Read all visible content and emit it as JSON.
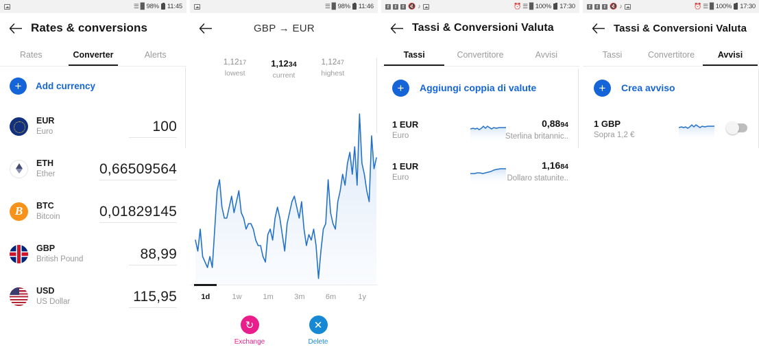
{
  "panels": {
    "p1": {
      "status": {
        "time": "11:45",
        "battery": "98%",
        "icons": [
          "image-icon",
          "wifi-icon",
          "signal-icon",
          "battery-icon"
        ]
      },
      "title": "Rates & conversions",
      "back_icon": "back-arrow-icon",
      "tabs": [
        {
          "label": "Rates",
          "active": false
        },
        {
          "label": "Converter",
          "active": true
        },
        {
          "label": "Alerts",
          "active": false
        }
      ],
      "add_currency": {
        "label": "Add currency",
        "icon": "plus-icon"
      },
      "currencies": [
        {
          "code": "EUR",
          "name": "Euro",
          "value": "100",
          "icon": "eur-flag-icon"
        },
        {
          "code": "ETH",
          "name": "Ether",
          "value": "0,66509564",
          "icon": "ethereum-icon"
        },
        {
          "code": "BTC",
          "name": "Bitcoin",
          "value": "0,01829145",
          "icon": "bitcoin-icon"
        },
        {
          "code": "GBP",
          "name": "British Pound",
          "value": "88,99",
          "icon": "gbp-flag-icon"
        },
        {
          "code": "USD",
          "name": "US Dollar",
          "value": "115,95",
          "icon": "usd-flag-icon"
        }
      ]
    },
    "p2": {
      "status": {
        "time": "11:46",
        "battery": "98%"
      },
      "title": "GBP → EUR",
      "from": "GBP",
      "to": "EUR",
      "stats": [
        {
          "big": "1,12",
          "small": "17",
          "label": "lowest"
        },
        {
          "big": "1,12",
          "small": "34",
          "label": "current"
        },
        {
          "big": "1,12",
          "small": "47",
          "label": "highest"
        }
      ],
      "ranges": [
        {
          "label": "1d",
          "active": true
        },
        {
          "label": "1w",
          "active": false
        },
        {
          "label": "1m",
          "active": false
        },
        {
          "label": "3m",
          "active": false
        },
        {
          "label": "6m",
          "active": false
        },
        {
          "label": "1y",
          "active": false
        }
      ],
      "actions": [
        {
          "label": "Exchange",
          "icon": "exchange-icon",
          "color": "#e91e8c"
        },
        {
          "label": "Delete",
          "icon": "close-icon",
          "color": "#1789d4"
        }
      ],
      "chart_line_color": "#2472c8",
      "chart_fill_color": "#d8e6f7"
    },
    "p3": {
      "status": {
        "time": "17:30",
        "battery": "100%",
        "icons": [
          "facebook-icon",
          "facebook-icon",
          "facebook-icon",
          "mute-icon",
          "vibrate-icon",
          "image-icon",
          "alarm-icon",
          "wifi-icon",
          "signal-icon",
          "battery-icon"
        ]
      },
      "title": "Tassi & Conversioni Valuta",
      "tabs": [
        {
          "label": "Tassi",
          "active": true
        },
        {
          "label": "Convertitore",
          "active": false
        },
        {
          "label": "Avvisi",
          "active": false
        }
      ],
      "add_pair": {
        "label": "Aggiungi coppia di valute",
        "icon": "plus-icon"
      },
      "pairs": [
        {
          "amount": "1 EUR",
          "sub": "Euro",
          "rate_big": "0,88",
          "rate_small": "94",
          "target": "Sterlina britannic..",
          "spark": "volatile"
        },
        {
          "amount": "1 EUR",
          "sub": "Euro",
          "rate_big": "1,16",
          "rate_small": "84",
          "target": "Dollaro statunite..",
          "spark": "rising"
        }
      ]
    },
    "p4": {
      "status": {
        "time": "17:30",
        "battery": "100%"
      },
      "title": "Tassi & Conversioni Valuta",
      "tabs": [
        {
          "label": "Tassi",
          "active": false
        },
        {
          "label": "Convertitore",
          "active": false
        },
        {
          "label": "Avvisi",
          "active": true
        }
      ],
      "create_alert": {
        "label": "Crea avviso",
        "icon": "plus-icon"
      },
      "alerts": [
        {
          "pair": "1 GBP",
          "condition": "Sopra 1,2 €",
          "enabled": false,
          "spark": "volatile"
        }
      ]
    }
  },
  "chart_data": {
    "type": "line",
    "title": "GBP → EUR",
    "xlabel": "",
    "ylabel": "",
    "ylim": [
      1.1217,
      1.1247
    ],
    "current": 1.1234,
    "lowest": 1.1217,
    "highest": 1.1247,
    "range_selected": "1d",
    "grid": false,
    "legend": "none",
    "series": [
      {
        "name": "GBP/EUR",
        "values": [
          1.1224,
          1.1222,
          1.1226,
          1.1221,
          1.122,
          1.1219,
          1.1221,
          1.1219,
          1.1226,
          1.1233,
          1.1235,
          1.123,
          1.1228,
          1.1228,
          1.123,
          1.1232,
          1.1229,
          1.1231,
          1.1233,
          1.1229,
          1.1228,
          1.1226,
          1.1227,
          1.1227,
          1.1226,
          1.1224,
          1.1223,
          1.1223,
          1.1221,
          1.122,
          1.1225,
          1.1226,
          1.1224,
          1.1228,
          1.123,
          1.1228,
          1.1225,
          1.1222,
          1.1227,
          1.1229,
          1.1231,
          1.1232,
          1.123,
          1.1228,
          1.1231,
          1.1226,
          1.1223,
          1.1225,
          1.1224,
          1.1226,
          1.1223,
          1.1217,
          1.1222,
          1.1226,
          1.1227,
          1.1235,
          1.1229,
          1.1227,
          1.1226,
          1.1231,
          1.1233,
          1.1236,
          1.1234,
          1.1238,
          1.124,
          1.1236,
          1.1241,
          1.1234,
          1.1247,
          1.1238,
          1.1236,
          1.1233,
          1.1231,
          1.1243,
          1.1237,
          1.1239
        ]
      }
    ]
  }
}
